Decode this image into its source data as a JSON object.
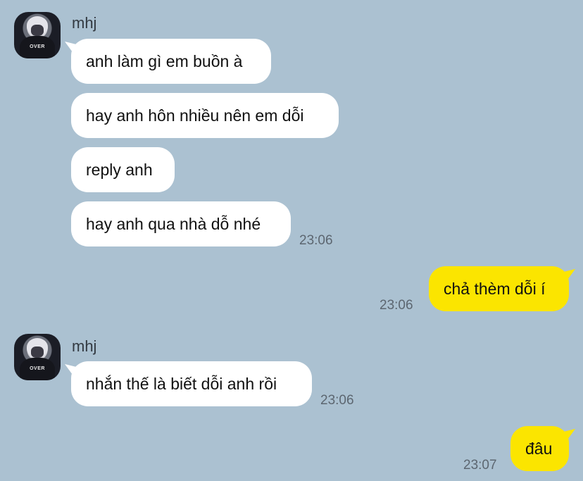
{
  "messages": [
    {
      "sender": "mhj",
      "text": "anh làm gì em buồn à"
    },
    {
      "text": "hay anh hôn nhiều nên em dỗi"
    },
    {
      "text": "reply anh"
    },
    {
      "text": "hay anh qua nhà dỗ nhé",
      "time": "23:06"
    },
    {
      "text": "chả thèm dỗi í",
      "time": "23:06"
    },
    {
      "sender": "mhj",
      "text": "nhắn thế là biết dỗi anh rồi",
      "time": "23:06"
    },
    {
      "text": "đâu",
      "time": "23:07"
    }
  ],
  "avatar": {
    "logo_text": "OVER"
  },
  "colors": {
    "background": "#abc1d1",
    "incoming_bubble": "#ffffff",
    "outgoing_bubble": "#fbe500",
    "timestamp": "#5c6670"
  },
  "icons": [
    "profile-avatar"
  ]
}
